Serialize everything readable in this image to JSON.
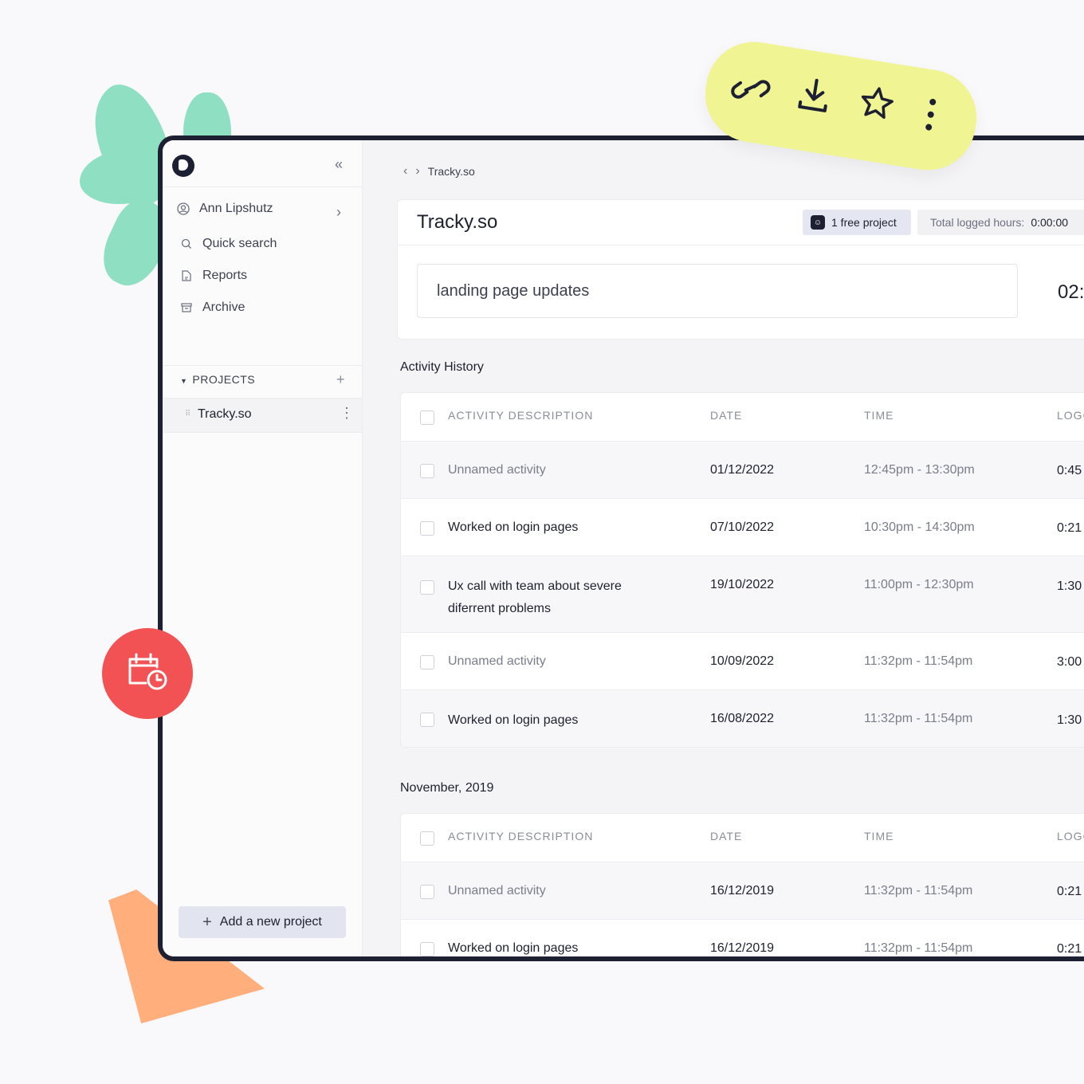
{
  "sidebar": {
    "user_name": "Ann Lipshutz",
    "nav": [
      {
        "label": "Quick search",
        "icon": "search-icon"
      },
      {
        "label": "Reports",
        "icon": "file-icon"
      },
      {
        "label": "Archive",
        "icon": "archive-icon"
      }
    ],
    "projects_heading": "PROJECTS",
    "projects": [
      {
        "name": "Tracky.so"
      }
    ],
    "add_project_label": "Add a new project"
  },
  "breadcrumb": {
    "current": "Tracky.so"
  },
  "project": {
    "title": "Tracky.so",
    "free_badge": "1 free project",
    "hours_label": "Total logged hours:",
    "hours_value": "0:00:00",
    "current_task": "landing page updates",
    "timer": "02:"
  },
  "table_headers": {
    "description": "ACTIVITY DESCRIPTION",
    "date": "DATE",
    "time": "TIME",
    "logged": "LOGG"
  },
  "sections": [
    {
      "title": "Activity History",
      "rows": [
        {
          "description": "Unnamed activity",
          "date": "01/12/2022",
          "time": "12:45pm - 13:30pm",
          "logged": "0:45"
        },
        {
          "description": "Worked on login pages",
          "date": "07/10/2022",
          "time": "10:30pm - 14:30pm",
          "logged": "0:21"
        },
        {
          "description": "Ux call with team about severe",
          "description2": "diferrent problems",
          "date": "19/10/2022",
          "time": "11:00pm - 12:30pm",
          "logged": "1:30"
        },
        {
          "description": "Unnamed activity",
          "date": "10/09/2022",
          "time": "11:32pm - 11:54pm",
          "logged": "3:00"
        },
        {
          "description": "Worked on login pages",
          "date": "16/08/2022",
          "time": "11:32pm - 11:54pm",
          "logged": "1:30"
        }
      ]
    },
    {
      "title": "November, 2019",
      "rows": [
        {
          "description": "Unnamed activity",
          "date": "16/12/2019",
          "time": "11:32pm - 11:54pm",
          "logged": "0:21"
        },
        {
          "description": "Worked on login pages",
          "date": "16/12/2019",
          "time": "11:32pm - 11:54pm",
          "logged": "0:21"
        }
      ]
    }
  ],
  "floating_toolbar": {
    "icons": [
      "link-icon",
      "download-icon",
      "star-icon",
      "more-vertical-icon"
    ],
    "color": "#f1f493"
  },
  "colors": {
    "frame": "#1d2033",
    "accent_red": "#f25253",
    "leaf_green": "#8fe0c3",
    "orange": "#ffae7c"
  }
}
